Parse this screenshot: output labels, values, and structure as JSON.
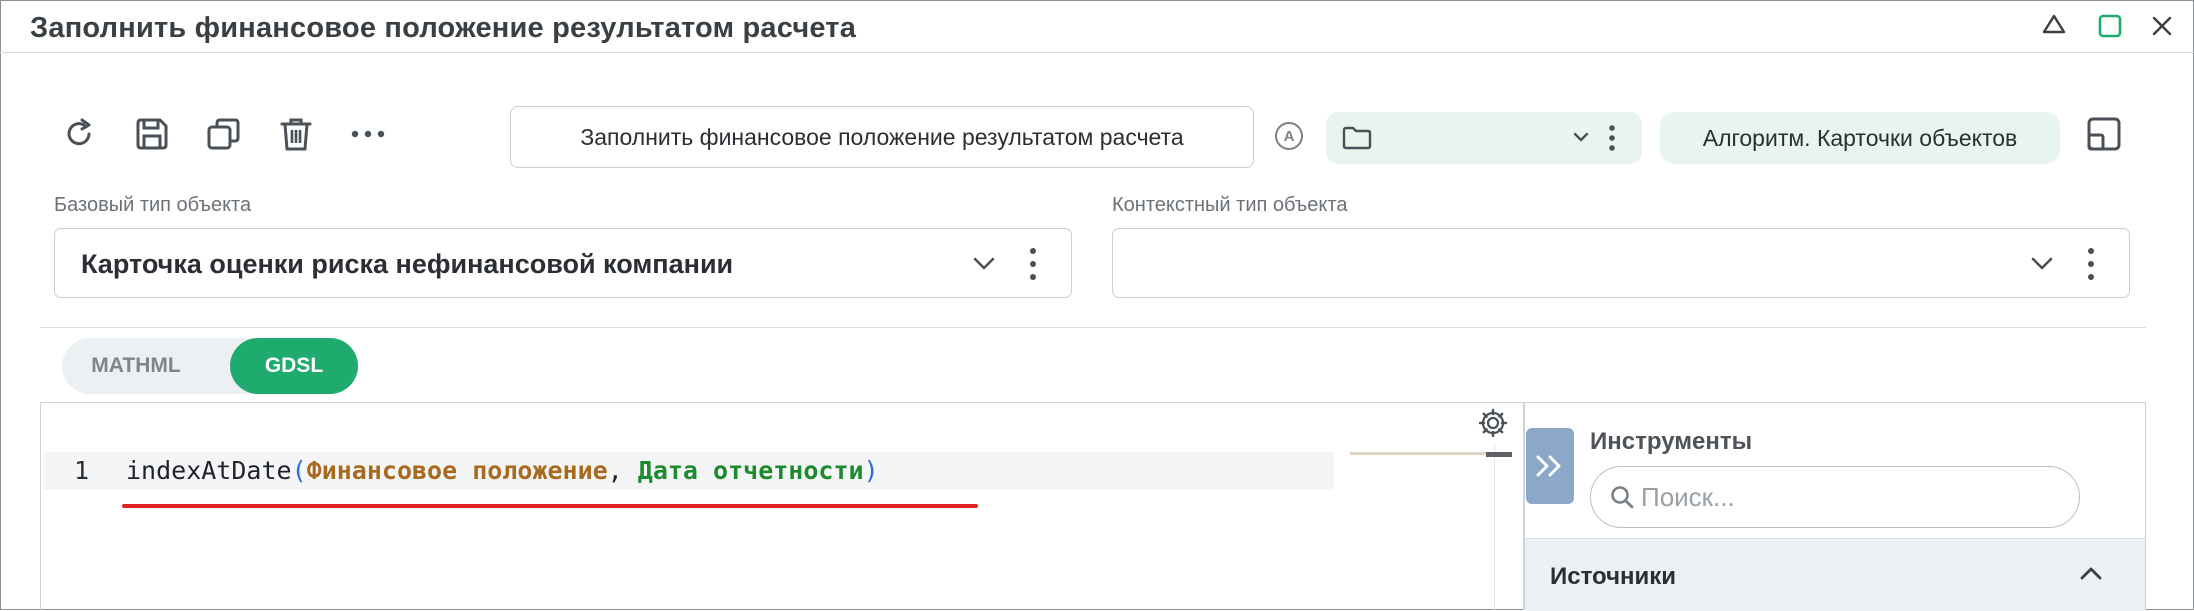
{
  "window": {
    "title": "Заполнить финансовое положение результатом расчета",
    "icons": [
      "droplet-icon",
      "maximize-icon",
      "close-icon"
    ],
    "accent_color": "#1faa6e"
  },
  "toolbar": {
    "icons": [
      "refresh-icon",
      "save-icon",
      "copy-icon",
      "delete-icon",
      "more-icon"
    ],
    "name_value": "Заполнить финансовое положение результатом расчета",
    "a_badge": "A",
    "folder_value": "",
    "algo_chip": "Алгоритм. Карточки объектов"
  },
  "fields": {
    "base_type_label": "Базовый тип объекта",
    "base_type_value": "Карточка оценки риска нефинансовой компании",
    "context_type_label": "Контекстный тип объекта",
    "context_type_value": ""
  },
  "tabs": [
    {
      "label": "MATHML",
      "active": false
    },
    {
      "label": "GDSL",
      "active": true
    }
  ],
  "editor": {
    "line_number": "1",
    "code": {
      "fn": "indexAtDate",
      "open": "(",
      "arg1": "Финансовое положение",
      "sep": ", ",
      "arg2": "Дата отчетности",
      "close": ")"
    },
    "error_underline_color": "#e01f26"
  },
  "tools_panel": {
    "title": "Инструменты",
    "search_placeholder": "Поиск...",
    "section_title": "Источники"
  }
}
